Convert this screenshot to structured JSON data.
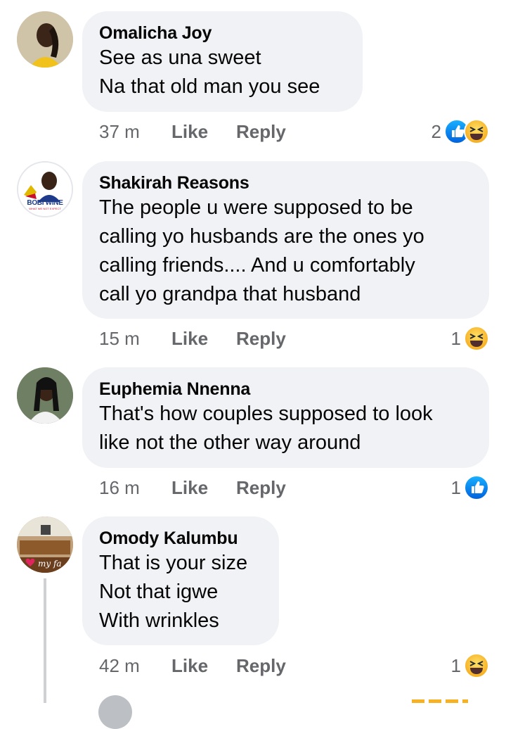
{
  "comments": [
    {
      "author": "Omalicha Joy",
      "lines": [
        "See as una sweet",
        "Na that old man you see"
      ],
      "time": "37 m",
      "like": "Like",
      "reply": "Reply",
      "reaction_count": "2",
      "reactions": [
        "like-icon",
        "haha-icon"
      ]
    },
    {
      "author": "Shakirah Reasons",
      "avatar_text": [
        "BOBI WINE",
        "WHAT WE NOT EXPECT"
      ],
      "lines": [
        "The people u were supposed to be",
        "calling yo husbands are the ones yo",
        "calling friends.... And u comfortably",
        "call yo grandpa that husband"
      ],
      "time": "15 m",
      "like": "Like",
      "reply": "Reply",
      "reaction_count": "1",
      "reactions": [
        "haha-icon"
      ]
    },
    {
      "author": "Euphemia Nnenna",
      "lines": [
        "That's how couples supposed to look",
        "like not the other way around"
      ],
      "time": "16 m",
      "like": "Like",
      "reply": "Reply",
      "reaction_count": "1",
      "reactions": [
        "like-icon"
      ]
    },
    {
      "author": "Omody Kalumbu",
      "avatar_text": "my fa",
      "lines": [
        "That is your size",
        "Not that igwe",
        "With wrinkles"
      ],
      "time": "42 m",
      "like": "Like",
      "reply": "Reply",
      "reaction_count": "1",
      "reactions": [
        "haha-icon"
      ]
    }
  ],
  "colors": {
    "bubble": "#f0f2f5",
    "meta": "#65676b",
    "like_blue": "#1877f2",
    "haha_yellow": "#f7b125"
  }
}
